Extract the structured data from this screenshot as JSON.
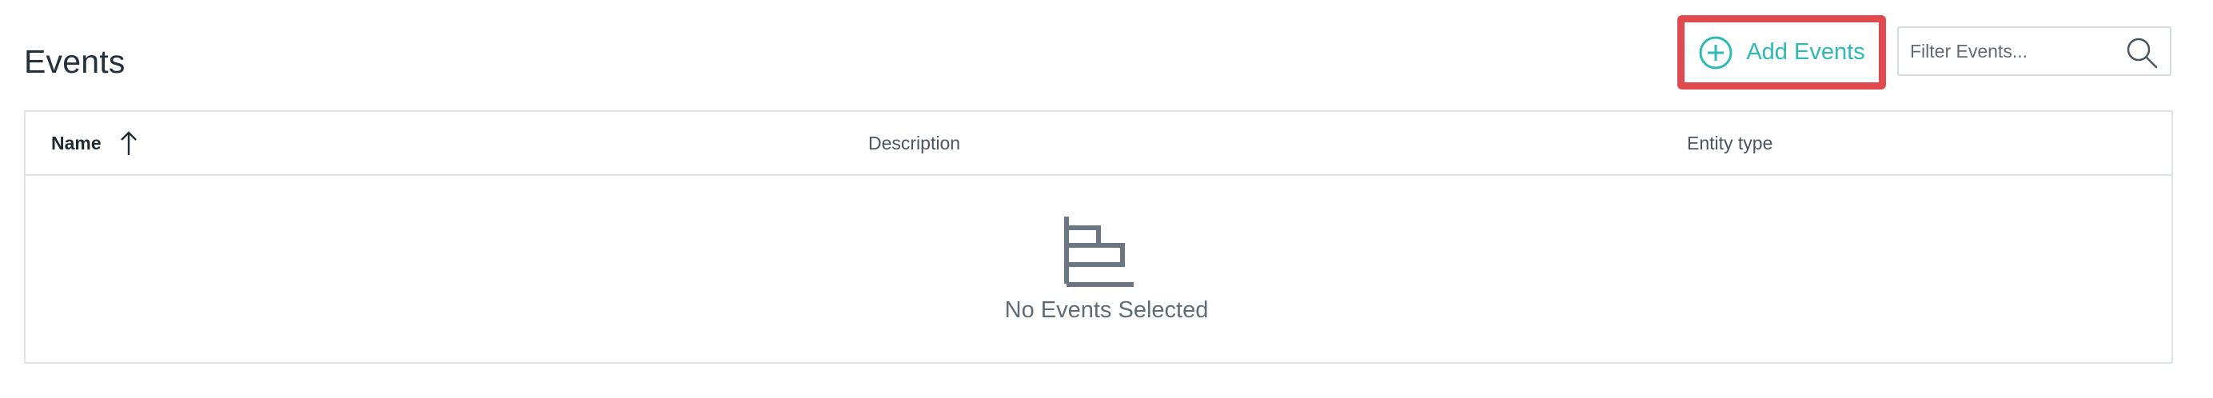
{
  "page": {
    "title": "Events"
  },
  "toolbar": {
    "add_label": "Add Events",
    "filter_placeholder": "Filter Events..."
  },
  "table": {
    "columns": [
      {
        "label": "Name",
        "sorted": "ascending"
      },
      {
        "label": "Description"
      },
      {
        "label": "Entity type"
      }
    ],
    "rows": [],
    "empty_message": "No Events Selected"
  },
  "colors": {
    "accent": "#2db9b5",
    "highlight_border": "#e04a4f",
    "text": "#24303a",
    "border": "#dde2e6"
  },
  "icons": {
    "add": "plus-circle-icon",
    "search": "search-icon",
    "sort": "arrow-up-icon",
    "empty": "bar-chart-icon"
  }
}
